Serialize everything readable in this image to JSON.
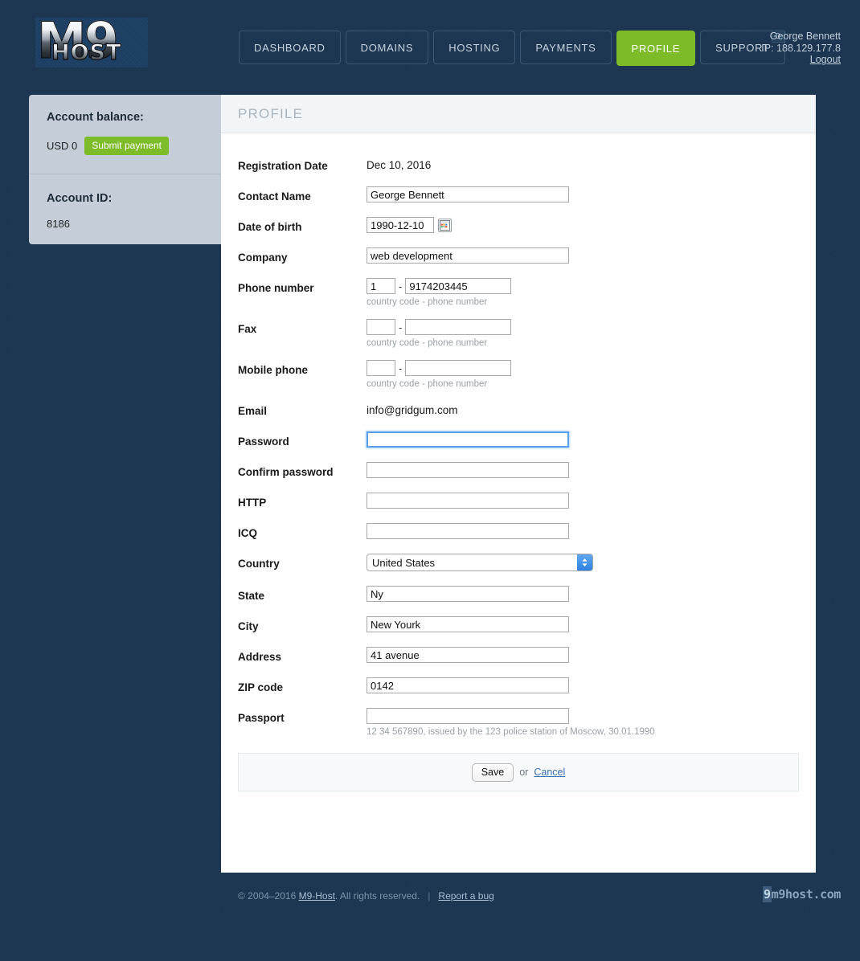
{
  "brand": {
    "logo_main": "M9",
    "logo_sub": "HOST"
  },
  "nav": {
    "items": [
      {
        "label": "DASHBOARD",
        "active": false
      },
      {
        "label": "DOMAINS",
        "active": false
      },
      {
        "label": "HOSTING",
        "active": false
      },
      {
        "label": "PAYMENTS",
        "active": false
      },
      {
        "label": "PROFILE",
        "active": true
      },
      {
        "label": "SUPPORT",
        "active": false,
        "badge": "0"
      }
    ]
  },
  "user": {
    "name": "George Bennett",
    "ip": "IP: 188.129.177.8",
    "logout": "Logout"
  },
  "sidebar": {
    "balance_title": "Account balance:",
    "balance_value": "USD 0",
    "submit_payment": "Submit payment",
    "account_id_title": "Account ID:",
    "account_id_value": "8186"
  },
  "panel": {
    "title": "PROFILE"
  },
  "form": {
    "registration_date": {
      "label": "Registration Date",
      "value": "Dec 10, 2016"
    },
    "contact_name": {
      "label": "Contact Name",
      "value": "George Bennett"
    },
    "date_of_birth": {
      "label": "Date of birth",
      "value": "1990-12-10",
      "icon": "calendar-icon"
    },
    "company": {
      "label": "Company",
      "value": "web development"
    },
    "phone": {
      "label": "Phone number",
      "country_code": "1",
      "number": "9174203445",
      "separator": "-",
      "hint": "country code - phone number"
    },
    "fax": {
      "label": "Fax",
      "country_code": "",
      "number": "",
      "separator": "-",
      "hint": "country code - phone number"
    },
    "mobile": {
      "label": "Mobile phone",
      "country_code": "",
      "number": "",
      "separator": "-",
      "hint": "country code - phone number"
    },
    "email": {
      "label": "Email",
      "value": "info@gridgum.com"
    },
    "password": {
      "label": "Password",
      "value": "",
      "focused": true
    },
    "confirm_password": {
      "label": "Confirm password",
      "value": ""
    },
    "http": {
      "label": "HTTP",
      "value": ""
    },
    "icq": {
      "label": "ICQ",
      "value": ""
    },
    "country": {
      "label": "Country",
      "value": "United States"
    },
    "state": {
      "label": "State",
      "value": "Ny"
    },
    "city": {
      "label": "City",
      "value": "New Yourk"
    },
    "address": {
      "label": "Address",
      "value": "41 avenue"
    },
    "zip": {
      "label": "ZIP code",
      "value": "0142"
    },
    "passport": {
      "label": "Passport",
      "value": "",
      "hint": "12 34 567890, issued by the 123 police station of Moscow, 30.01.1990"
    }
  },
  "actions": {
    "save": "Save",
    "or": "or",
    "cancel": "Cancel"
  },
  "footer": {
    "copyright_prefix": "© 2004–2016 ",
    "brand_link": "M9-Host",
    "copyright_suffix": ". All rights reserved.",
    "separator": "|",
    "report_bug": "Report a bug",
    "logo_highlight": "9",
    "logo_rest": "m9host.com"
  },
  "colors": {
    "background": "#1d3651",
    "accent_green": "#7dbc28",
    "sidebar": "#c5ced8",
    "panel": "#ffffff",
    "focus_blue": "#5aa0e8"
  }
}
